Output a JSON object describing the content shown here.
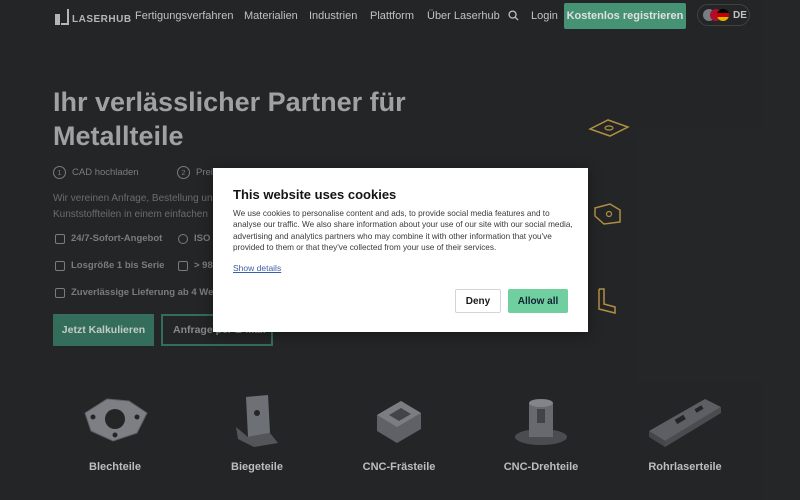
{
  "header": {
    "logo_text": "LASERHUB",
    "nav": [
      "Fertigungsverfahren",
      "Materialien",
      "Industrien",
      "Plattform",
      "Über Laserhub"
    ],
    "login": "Login",
    "cta": "Kostenlos registrieren",
    "lang": "DE"
  },
  "hero": {
    "title": "Ihr verlässlicher Partner für Metallteile",
    "steps": [
      {
        "num": "1",
        "label": "CAD hochladen"
      },
      {
        "num": "2",
        "label": "Prei"
      }
    ],
    "description_line1": "Wir vereinen Anfrage, Bestellung un",
    "description_line2": "Kunststoffteilen in einem einfachen",
    "features": [
      "24/7-Sofort-Angebot",
      "ISO",
      "Losgröße 1 bis Serie",
      "> 98",
      "Zuverlässige Lieferung ab 4 We"
    ],
    "btn_calc": "Jetzt Kalkulieren",
    "btn_mail": "Anfrage per E-Mail"
  },
  "products": [
    "Blechteile",
    "Biegeteile",
    "CNC-Frästeile",
    "CNC-Drehteile",
    "Rohrlaserteile"
  ],
  "cookie": {
    "title": "This website uses cookies",
    "body": "We use cookies to personalise content and ads, to provide social media features and to analyse our traffic. We also share information about your use of our site with our social media, advertising and analytics partners who may combine it with other information that you've provided to them or that they've collected from your use of their services.",
    "show_details": "Show details",
    "deny": "Deny",
    "allow": "Allow all"
  },
  "colors": {
    "background": "#2a2b2d",
    "accent": "#4fa785",
    "allow_button": "#6fcf9f"
  }
}
